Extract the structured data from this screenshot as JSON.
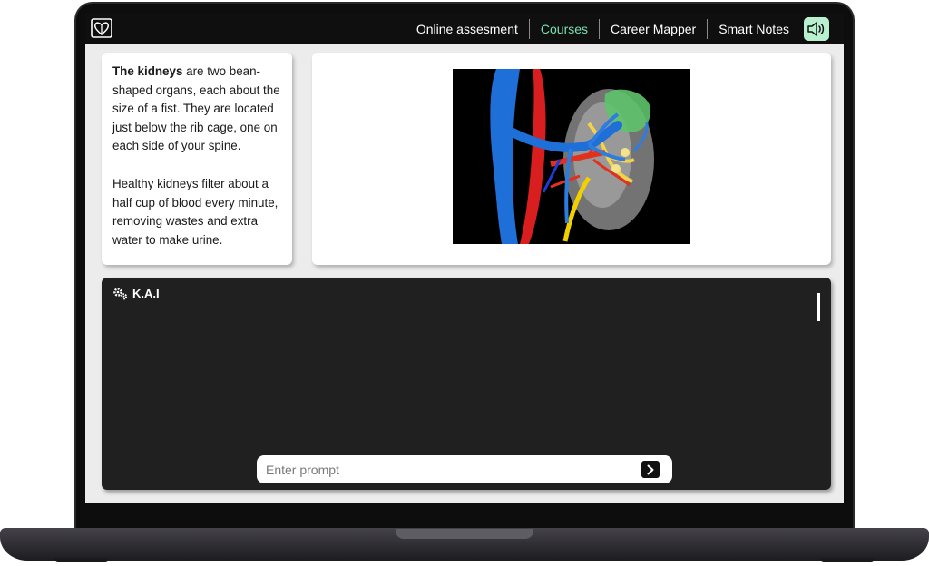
{
  "nav": {
    "items": [
      {
        "label": "Online assesment",
        "active": false
      },
      {
        "label": "Courses",
        "active": true
      },
      {
        "label": "Career Mapper",
        "active": false
      },
      {
        "label": "Smart Notes",
        "active": false
      }
    ],
    "speaker_icon": "speaker-sound-icon",
    "accent_color": "#7be0b0"
  },
  "logo_icon": "heart-brain-logo-icon",
  "lesson": {
    "p1_bold": "The kidneys",
    "p1_rest": " are two bean-shaped organs, each about the size of a fist. They are located just below the rib cage, one on each side of your spine.",
    "p2": "Healthy kidneys filter about a half cup of blood every minute, removing wastes and extra water to make urine."
  },
  "illustration": "kidney anatomy 3D render",
  "kai": {
    "title": "K.A.I",
    "icon": "gears-icon",
    "prompt_placeholder": "Enter prompt",
    "send_icon": "chevron-right-icon"
  }
}
